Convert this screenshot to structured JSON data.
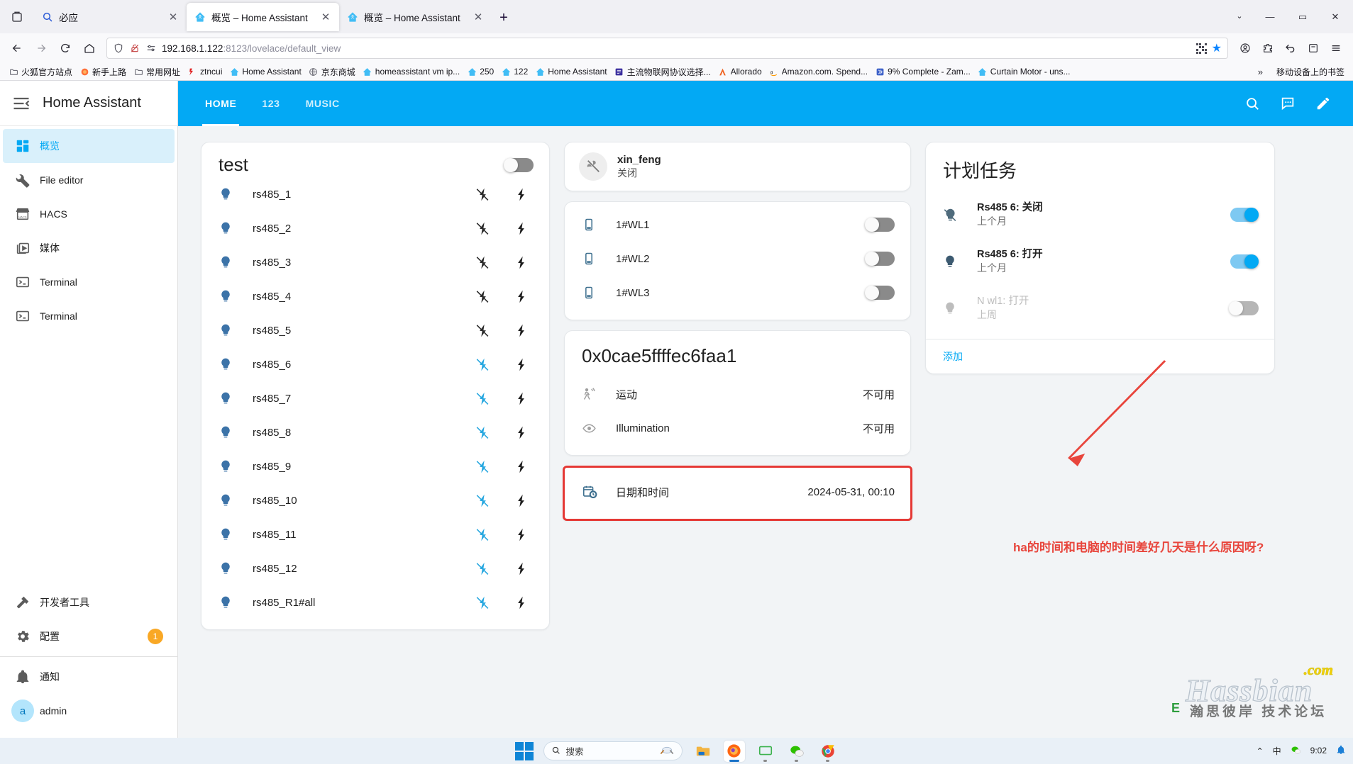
{
  "browser": {
    "tabs": [
      {
        "title": "必应",
        "icon": "bing-search-icon",
        "active": false
      },
      {
        "title": "概览 – Home Assistant",
        "icon": "home-assistant-icon",
        "active": true
      },
      {
        "title": "概览 – Home Assistant",
        "icon": "home-assistant-icon",
        "active": false
      }
    ],
    "new_tab_label": "+",
    "list_all_tabs_label": "⌄",
    "window_buttons": {
      "minimize": "—",
      "maximize": "▭",
      "close": "✕"
    },
    "url": {
      "host": "192.168.1.122",
      "rest": ":8123/lovelace/default_view"
    },
    "bookmarks": [
      {
        "label": "火狐官方站点",
        "icon": "folder-icon"
      },
      {
        "label": "新手上路",
        "icon": "firefox-icon"
      },
      {
        "label": "常用网址",
        "icon": "folder-icon"
      },
      {
        "label": "ztncui",
        "icon": "ztncui-icon"
      },
      {
        "label": "Home Assistant",
        "icon": "home-assistant-icon"
      },
      {
        "label": "京东商城",
        "icon": "globe-icon"
      },
      {
        "label": "homeassistant vm ip...",
        "icon": "home-assistant-icon"
      },
      {
        "label": "250",
        "icon": "home-assistant-icon"
      },
      {
        "label": "122",
        "icon": "home-assistant-icon"
      },
      {
        "label": "Home Assistant",
        "icon": "home-assistant-icon"
      },
      {
        "label": "主流物联网协议选择...",
        "icon": "article-icon"
      },
      {
        "label": "Allorado",
        "icon": "allorado-icon"
      },
      {
        "label": "Amazon.com. Spend...",
        "icon": "amazon-icon"
      },
      {
        "label": "9% Complete - Zam...",
        "icon": "zam-icon"
      },
      {
        "label": "Curtain Motor - uns...",
        "icon": "home-assistant-icon"
      }
    ],
    "bookmarks_overflow": "»",
    "mobile_bookmarks": "移动设备上的书签"
  },
  "sidebar": {
    "title": "Home Assistant",
    "items": [
      {
        "label": "概览",
        "icon": "dashboard-icon",
        "selected": true
      },
      {
        "label": "File editor",
        "icon": "wrench-icon",
        "selected": false
      },
      {
        "label": "HACS",
        "icon": "hacs-store-icon",
        "selected": false
      },
      {
        "label": "媒体",
        "icon": "media-play-icon",
        "selected": false
      },
      {
        "label": "Terminal",
        "icon": "terminal-icon",
        "selected": false
      },
      {
        "label": "Terminal",
        "icon": "terminal-icon",
        "selected": false
      }
    ],
    "bottom_items": [
      {
        "label": "开发者工具",
        "icon": "hammer-icon",
        "badge": ""
      },
      {
        "label": "配置",
        "icon": "gear-icon",
        "badge": "1"
      }
    ],
    "footer_items": [
      {
        "label": "通知",
        "icon": "bell-icon"
      },
      {
        "label": "admin",
        "icon": "avatar",
        "avatar_letter": "a"
      }
    ]
  },
  "toolbar": {
    "tabs": [
      {
        "label": "HOME",
        "active": true
      },
      {
        "label": "123",
        "active": false
      },
      {
        "label": "MUSIC",
        "active": false
      }
    ],
    "actions": [
      {
        "name": "search-icon"
      },
      {
        "name": "assist-conversation-icon"
      },
      {
        "name": "edit-pencil-icon"
      }
    ],
    "accent_color": "#03a9f4"
  },
  "cards": {
    "test_card": {
      "title": "test",
      "header_toggle": "off",
      "rows": [
        {
          "name": "rs485_1",
          "icon": "lightbulb-icon",
          "flash_off_active": false
        },
        {
          "name": "rs485_2",
          "icon": "lightbulb-icon",
          "flash_off_active": false
        },
        {
          "name": "rs485_3",
          "icon": "lightbulb-icon",
          "flash_off_active": false
        },
        {
          "name": "rs485_4",
          "icon": "lightbulb-icon",
          "flash_off_active": false
        },
        {
          "name": "rs485_5",
          "icon": "lightbulb-icon",
          "flash_off_active": false
        },
        {
          "name": "rs485_6",
          "icon": "lightbulb-icon",
          "flash_off_active": true
        },
        {
          "name": "rs485_7",
          "icon": "lightbulb-icon",
          "flash_off_active": true
        },
        {
          "name": "rs485_8",
          "icon": "lightbulb-icon",
          "flash_off_active": true
        },
        {
          "name": "rs485_9",
          "icon": "lightbulb-icon",
          "flash_off_active": true
        },
        {
          "name": "rs485_10",
          "icon": "lightbulb-icon",
          "flash_off_active": true
        },
        {
          "name": "rs485_11",
          "icon": "lightbulb-icon",
          "flash_off_active": true
        },
        {
          "name": "rs485_12",
          "icon": "lightbulb-icon",
          "flash_off_active": true
        },
        {
          "name": "rs485_R1#all",
          "icon": "lightbulb-icon",
          "flash_off_active": true
        }
      ]
    },
    "xin_feng_card": {
      "name": "xin_feng",
      "state": "关闭",
      "icon": "fan-off-icon"
    },
    "wl_card": {
      "rows": [
        {
          "name": "1#WL1",
          "icon": "smartphone-icon",
          "toggle": "off"
        },
        {
          "name": "1#WL2",
          "icon": "smartphone-icon",
          "toggle": "off"
        },
        {
          "name": "1#WL3",
          "icon": "smartphone-icon",
          "toggle": "off"
        }
      ]
    },
    "sensor_card": {
      "title": "0x0cae5ffffec6faa1",
      "rows": [
        {
          "name": "运动",
          "icon": "motion-sensor-off-icon",
          "value": "不可用"
        },
        {
          "name": "Illumination",
          "icon": "eye-icon",
          "value": "不可用"
        }
      ]
    },
    "datetime_card": {
      "highlighted": true,
      "rows": [
        {
          "name": "日期和时间",
          "icon": "calendar-clock-icon",
          "value": "2024-05-31, 00:10"
        }
      ]
    },
    "schedule_card": {
      "title": "计划任务",
      "rows": [
        {
          "primary": "Rs485 6: 关闭",
          "secondary": "上个月",
          "icon": "lightbulb-off-icon",
          "toggle": "on",
          "dim": false
        },
        {
          "primary": "Rs485 6: 打开",
          "secondary": "上个月",
          "icon": "lightbulb-icon",
          "toggle": "on",
          "dim": false
        },
        {
          "primary": "N wl1: 打开",
          "secondary": "上周",
          "icon": "lightbulb-grey-icon",
          "toggle": "disabled",
          "dim": true
        }
      ],
      "footer_link": "添加"
    }
  },
  "annotations": {
    "question_text": "ha的时间和电脑的时间差好几天是什么原因呀?",
    "color": "#e8453c"
  },
  "watermark": {
    "main": "Hassbian",
    "tld": ".com",
    "subtitle": "瀚思彼岸 技术论坛"
  },
  "taskbar": {
    "search_placeholder": "搜索",
    "apps": [
      {
        "name": "file-explorer-icon",
        "active": false
      },
      {
        "name": "firefox-icon",
        "active": true
      },
      {
        "name": "screen-share-icon",
        "active": false
      },
      {
        "name": "wechat-icon",
        "active": false
      },
      {
        "name": "chrome-icon",
        "active": false
      }
    ],
    "tray": {
      "chevron": "⌃",
      "ime": "中",
      "clock_time": "9:02"
    }
  }
}
